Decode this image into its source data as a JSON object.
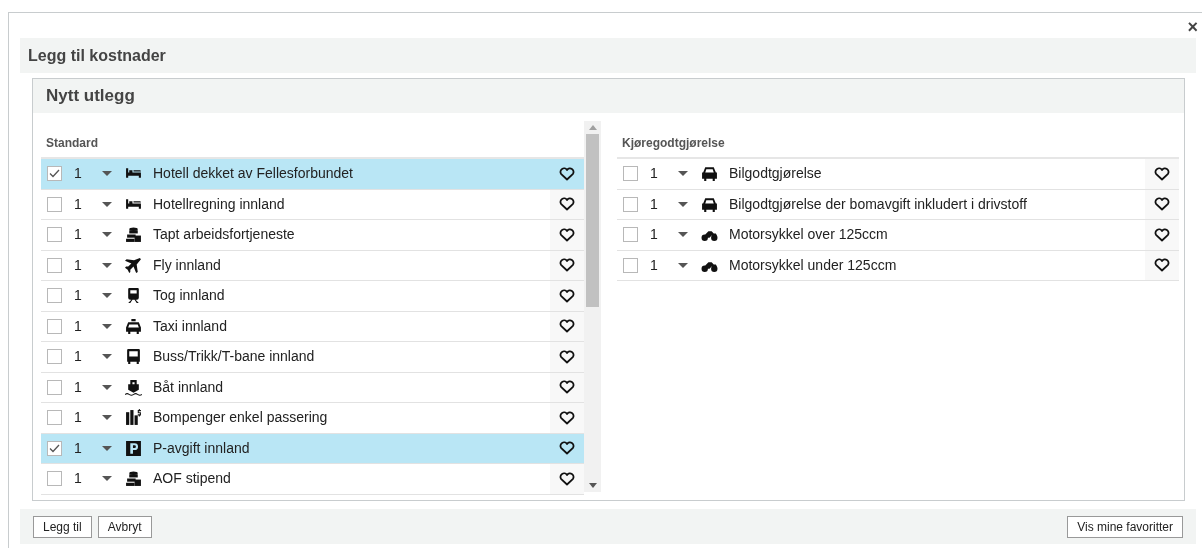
{
  "dialog": {
    "title": "Legg til kostnader",
    "close": "×"
  },
  "panel": {
    "title": "Nytt utlegg"
  },
  "groups": [
    {
      "title": "Standard",
      "rows": [
        {
          "checked": true,
          "qty": "1",
          "kind": "bed",
          "label": "Hotell dekket av Fellesforbundet"
        },
        {
          "checked": false,
          "qty": "1",
          "kind": "bed",
          "label": "Hotellregning innland"
        },
        {
          "checked": false,
          "qty": "1",
          "kind": "coins",
          "label": "Tapt arbeidsfortjeneste"
        },
        {
          "checked": false,
          "qty": "1",
          "kind": "plane",
          "label": "Fly innland"
        },
        {
          "checked": false,
          "qty": "1",
          "kind": "train",
          "label": "Tog innland"
        },
        {
          "checked": false,
          "qty": "1",
          "kind": "taxi",
          "label": "Taxi innland"
        },
        {
          "checked": false,
          "qty": "1",
          "kind": "bus",
          "label": "Buss/Trikk/T-bane innland"
        },
        {
          "checked": false,
          "qty": "1",
          "kind": "boat",
          "label": "Båt innland"
        },
        {
          "checked": false,
          "qty": "1",
          "kind": "toll",
          "label": "Bompenger enkel passering"
        },
        {
          "checked": true,
          "qty": "1",
          "kind": "parking",
          "label": "P-avgift innland"
        },
        {
          "checked": false,
          "qty": "1",
          "kind": "coins",
          "label": "AOF stipend"
        }
      ]
    },
    {
      "title": "Kjøregodtgjørelse",
      "rows": [
        {
          "checked": false,
          "qty": "1",
          "kind": "car",
          "label": "Bilgodtgjørelse"
        },
        {
          "checked": false,
          "qty": "1",
          "kind": "car",
          "label": "Bilgodtgjørelse der bomavgift inkludert i drivstoff"
        },
        {
          "checked": false,
          "qty": "1",
          "kind": "motorcycle",
          "label": "Motorsykkel over 125ccm"
        },
        {
          "checked": false,
          "qty": "1",
          "kind": "motorcycle",
          "label": "Motorsykkel under 125ccm"
        }
      ]
    }
  ],
  "footer": {
    "left_buttons": [
      "Legg til",
      "Avbryt"
    ],
    "right_button": "Vis mine favoritter"
  }
}
